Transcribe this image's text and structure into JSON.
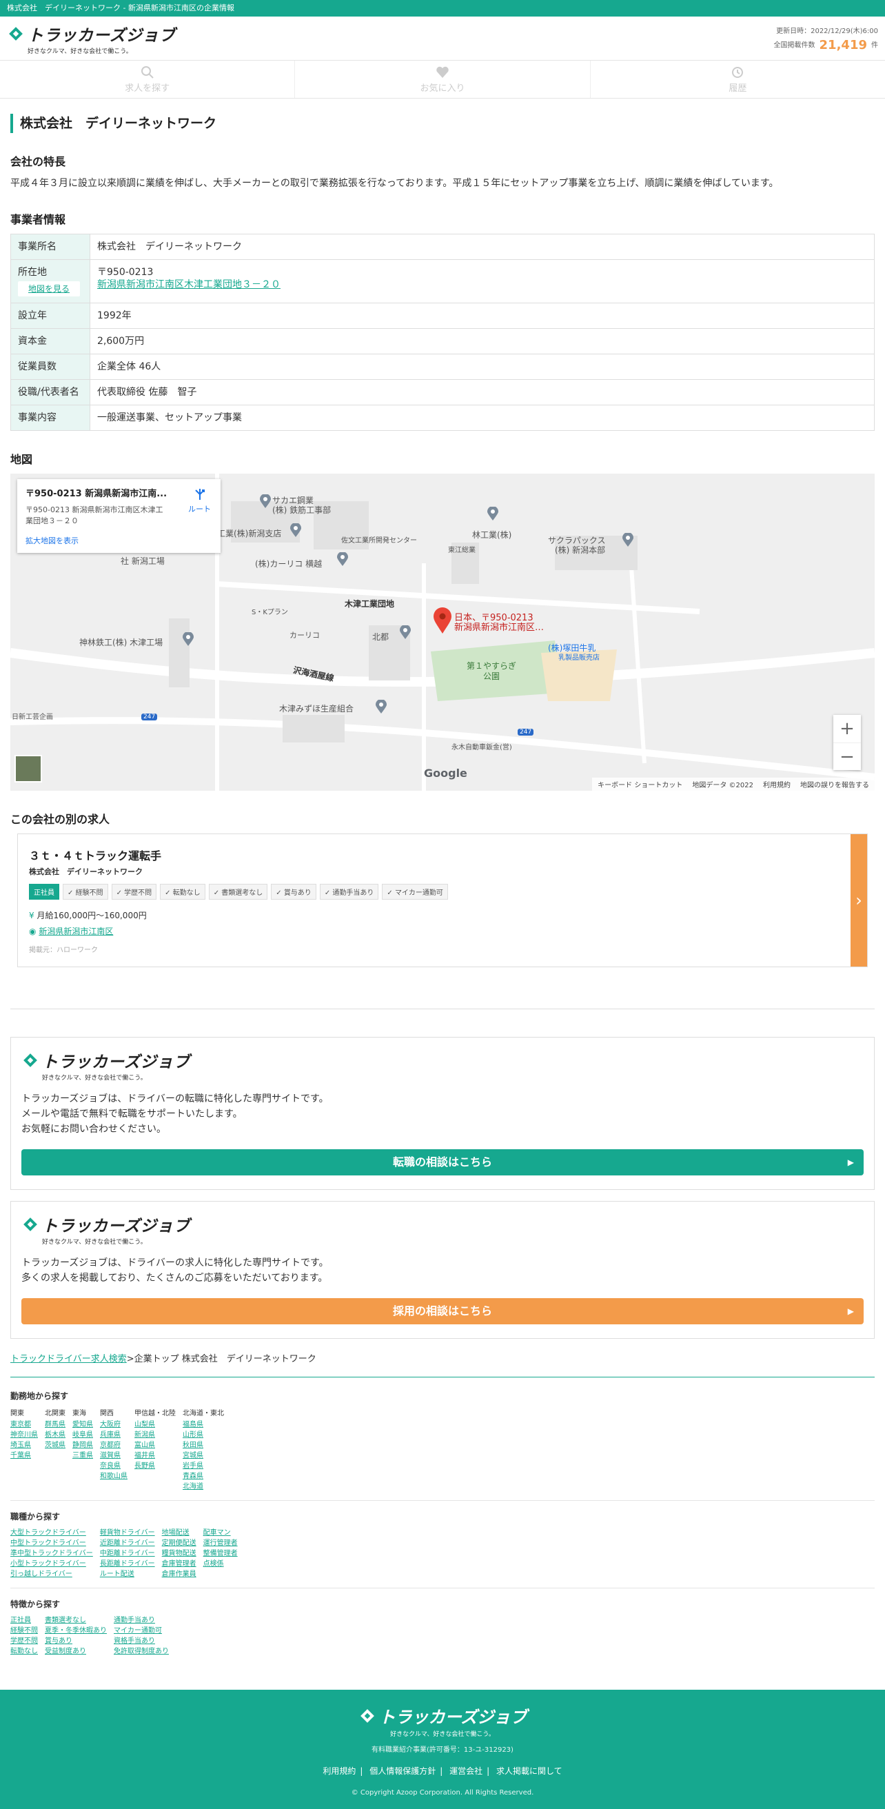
{
  "topbar": {
    "text": "株式会社　デイリーネットワーク - 新潟県新潟市江南区の企業情報"
  },
  "header": {
    "logo_text": "トラッカーズジョブ",
    "logo_sub": "好きなクルマ、好きな会社で働こう。",
    "updated": "更新日時：2022/12/29(木)6:00",
    "count_label": "全国掲載件数",
    "count": "21,419",
    "count_unit": "件"
  },
  "nav": [
    {
      "label": "求人を探す",
      "icon": "search-icon"
    },
    {
      "label": "お気に入り",
      "icon": "heart-icon"
    },
    {
      "label": "履歴",
      "icon": "history-icon"
    }
  ],
  "company": {
    "name": "株式会社　デイリーネットワーク",
    "feature_heading": "会社の特長",
    "feature_text": "平成４年３月に設立以来順調に業績を伸ばし、大手メーカーとの取引で業務拡張を行なっております。平成１５年にセットアップ事業を立ち上げ、順調に業績を伸ばしています。",
    "info_heading": "事業者情報",
    "rows": [
      {
        "k": "事業所名",
        "v": "株式会社　デイリーネットワーク"
      },
      {
        "k": "設立年",
        "v": "1992年"
      },
      {
        "k": "資本金",
        "v": "2,600万円"
      },
      {
        "k": "従業員数",
        "v": "企業全体 46人"
      },
      {
        "k": "役職/代表者名",
        "v": "代表取締役 佐藤　智子"
      },
      {
        "k": "事業内容",
        "v": "一般運送事業、セットアップ事業"
      }
    ],
    "address_label": "所在地",
    "map_btn": "地図を見る",
    "zip": "〒950-0213",
    "address": "新潟県新潟市江南区木津工業団地３－２０"
  },
  "map": {
    "heading": "地図",
    "card_title": "〒950-0213 新潟県新潟市江南...",
    "card_addr": "〒950-0213 新潟県新潟市江南区木津工業団地３－２０",
    "card_link": "拡大地図を表示",
    "route": "ルート",
    "pin_label1": "日本、〒950-0213",
    "pin_label2": "新潟県新潟市江南区…",
    "labels": {
      "l1": "サカエ鋼業",
      "l2": "(株) 鉄筋工事部",
      "l3": "工業(株)新潟支店",
      "l4": "佐文工業所開発センター",
      "l5": "林工業(株)",
      "l6": "サクラパックス",
      "l7": "(株) 新潟本部",
      "l8": "東江総業",
      "l9": "(株)カーリコ 横越",
      "l10": "S・Kプラン",
      "l11": "木津工業団地",
      "l12": "神林鉄工(株) 木津工場",
      "l13": "カーリコ",
      "l14": "北都",
      "l15": "(株)塚田牛乳",
      "l16": "乳製品販売店",
      "l17": "第１やすらぎ",
      "l18": "公園",
      "l19": "沢海酒屋線",
      "l20": "木津みずほ生産組合",
      "l21": "日新工芸企画",
      "l22": "永木自動車鈑金(営)",
      "l23": "社 新潟工場",
      "r1": "247",
      "r2": "247"
    },
    "google": "Google",
    "footer": [
      "キーボード ショートカット",
      "地図データ ©2022",
      "利用規約",
      "地図の誤りを報告する"
    ]
  },
  "jobs": {
    "heading": "この会社の別の求人",
    "items": [
      {
        "title": "３ｔ・４ｔトラック運転手",
        "company": "株式会社　デイリーネットワーク",
        "tags": [
          "正社員",
          "経験不問",
          "学歴不問",
          "転勤なし",
          "書類選考なし",
          "賞与あり",
          "通勤手当あり",
          "マイカー通勤可"
        ],
        "salary": "月給160,000円〜160,000円",
        "place": "新潟県新潟市江南区",
        "source": "掲載元：ハローワーク"
      }
    ]
  },
  "promo1": {
    "logo_text": "トラッカーズジョブ",
    "logo_sub": "好きなクルマ、好きな会社で働こう。",
    "line1": "トラッカーズジョブは、ドライバーの転職に特化した専門サイトです。",
    "line2": "メールや電話で無料で転職をサポートいたします。",
    "line3": "お気軽にお問い合わせください。",
    "button": "転職の相談はこちら"
  },
  "promo2": {
    "logo_text": "トラッカーズジョブ",
    "logo_sub": "好きなクルマ、好きな会社で働こう。",
    "line1": "トラッカーズジョブは、ドライバーの求人に特化した専門サイトです。",
    "line2": "多くの求人を掲載しており、たくさんのご応募をいただいております。",
    "button": "採用の相談はこちら"
  },
  "breadcrumb": {
    "link": "トラックドライバー求人検索",
    "sep": ">",
    "current": "企業トップ 株式会社　デイリーネットワーク"
  },
  "sitemap": {
    "area_heading": "勤務地から探す",
    "area_cols": [
      {
        "head": "関東",
        "items": [
          "東京都",
          "神奈川県",
          "埼玉県",
          "千葉県"
        ]
      },
      {
        "head": "北関東",
        "items": [
          "群馬県",
          "栃木県",
          "茨城県"
        ]
      },
      {
        "head": "東海",
        "items": [
          "愛知県",
          "岐阜県",
          "静岡県",
          "三重県"
        ]
      },
      {
        "head": "関西",
        "items": [
          "大阪府",
          "兵庫県",
          "京都府",
          "滋賀県",
          "奈良県",
          "和歌山県"
        ]
      },
      {
        "head": "甲信越・北陸",
        "items": [
          "山梨県",
          "新潟県",
          "富山県",
          "福井県",
          "長野県"
        ]
      },
      {
        "head": "北海道・東北",
        "items": [
          "福島県",
          "山形県",
          "秋田県",
          "宮城県",
          "岩手県",
          "青森県",
          "北海道"
        ]
      }
    ],
    "type_heading": "職種から探す",
    "type_cols": [
      [
        "大型トラックドライバー",
        "中型トラックドライバー",
        "準中型トラックドライバー",
        "小型トラックドライバー",
        "引っ越しドライバー"
      ],
      [
        "軽貨物ドライバー",
        "近距離ドライバー",
        "中距離ドライバー",
        "長距離ドライバー",
        "ルート配送"
      ],
      [
        "地場配送",
        "定期便配送",
        "糧貨物配送",
        "倉庫管理者",
        "倉庫作業員"
      ],
      [
        "配車マン",
        "運行管理者",
        "整備管理者",
        "点検係"
      ]
    ],
    "feature_heading": "特徴から探す",
    "feature_cols": [
      [
        "正社員",
        "経験不問",
        "学歴不問",
        "転勤なし"
      ],
      [
        "書類選考なし",
        "夏季・冬季休暇あり",
        "賞与あり",
        "受益制度あり"
      ],
      [
        "通勤手当あり",
        "マイカー通勤可",
        "資格手当あり",
        "免許取得制度あり"
      ]
    ]
  },
  "footer": {
    "logo_text": "トラッカーズジョブ",
    "logo_sub": "好きなクルマ、好きな会社で働こう。",
    "license": "有料職業紹介事業(許可番号：13-ユ-312923)",
    "links": [
      "利用規約",
      "個人情報保護方針",
      "運営会社",
      "求人掲載に関して"
    ],
    "copyright": "© Copyright Azoop Corporation. All Rights Reserved."
  },
  "colors": {
    "brand": "#16a88f",
    "accent": "#f39b4a"
  }
}
